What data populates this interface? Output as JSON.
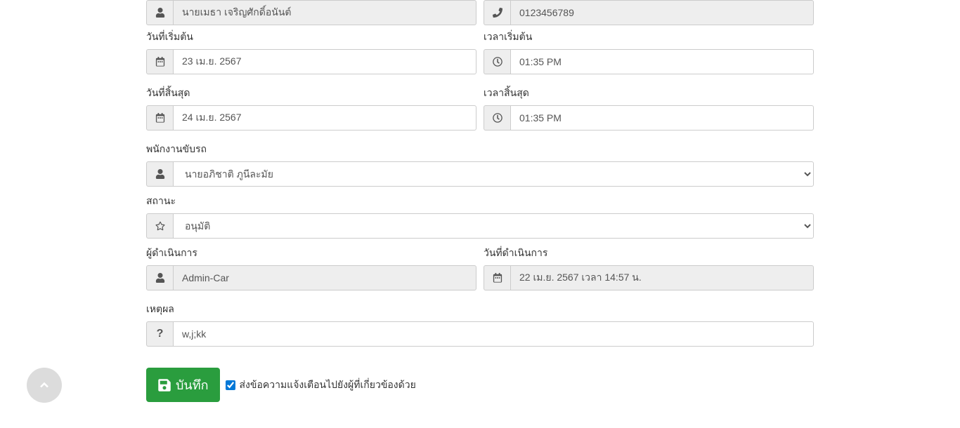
{
  "requester": {
    "name": "นายเมธา เจริญศักดิ์อนันต์",
    "phone": "0123456789"
  },
  "start": {
    "date_label": "วันที่เริ่มต้น",
    "date_value": "23 เม.ย. 2567",
    "time_label": "เวลาเริ่มต้น",
    "time_value": "01:35 PM"
  },
  "end": {
    "date_label": "วันที่สิ้นสุด",
    "date_value": "24 เม.ย. 2567",
    "time_label": "เวลาสิ้นสุด",
    "time_value": "01:35 PM"
  },
  "driver": {
    "label": "พนักงานขับรถ",
    "value": "นายอภิชาติ ภูนีละมัย"
  },
  "status": {
    "label": "สถานะ",
    "value": "อนุมัติ"
  },
  "operator": {
    "label": "ผู้ดำเนินการ",
    "value": "Admin-Car"
  },
  "operation_date": {
    "label": "วันที่ดำเนินการ",
    "value": "22 เม.ย. 2567 เวลา 14:57 น."
  },
  "reason": {
    "label": "เหตุผล",
    "value": "w,j;kk"
  },
  "actions": {
    "save_label": "บันทึก",
    "notify_label": "ส่งข้อความแจ้งเตือนไปยังผู้ที่เกี่ยวข้องด้วย"
  }
}
